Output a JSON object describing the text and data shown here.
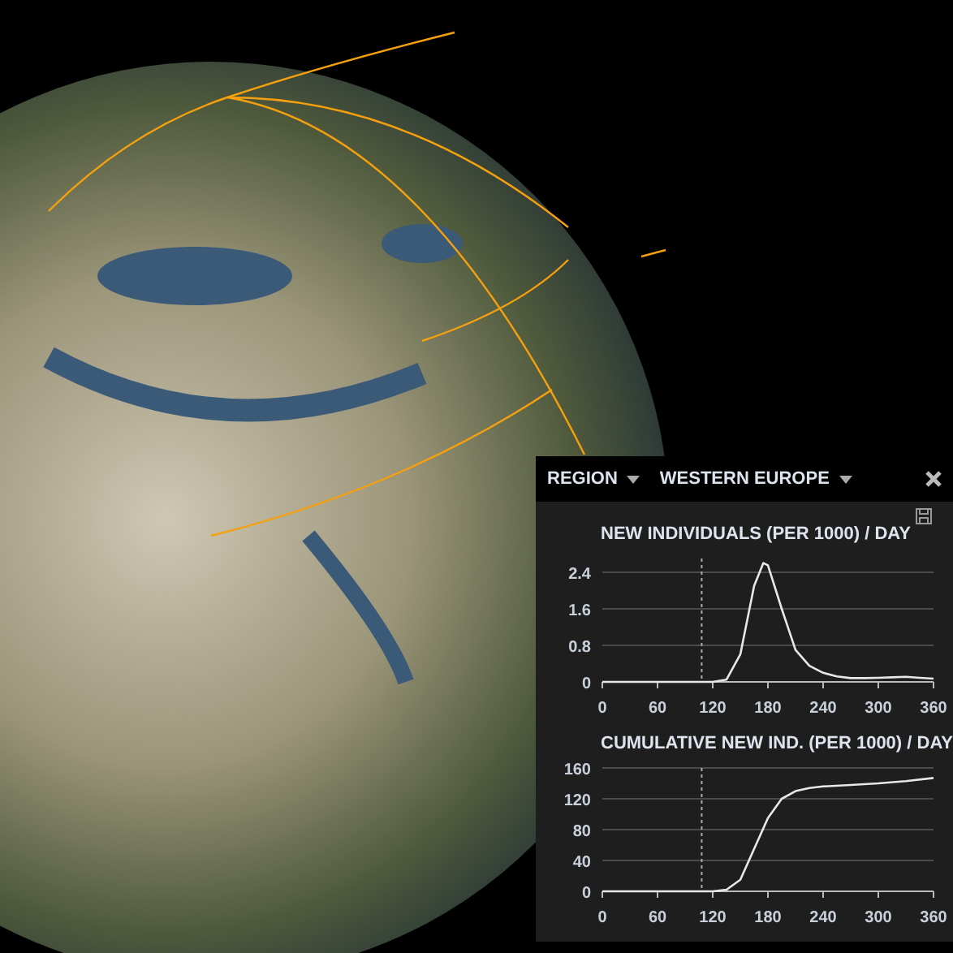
{
  "panel": {
    "region_label": "REGION",
    "region_value": "WESTERN EUROPE",
    "charts": [
      {
        "chart_data": {
          "type": "line",
          "title": "NEW INDIVIDUALS (PER 1000) / DAY",
          "x": [
            0,
            15,
            30,
            45,
            60,
            75,
            90,
            105,
            120,
            135,
            150,
            165,
            175,
            180,
            195,
            210,
            225,
            240,
            255,
            270,
            285,
            300,
            315,
            330,
            345,
            360
          ],
          "series": [
            {
              "color": "#e8e8e8",
              "values": [
                0,
                0,
                0,
                0,
                0,
                0,
                0,
                0,
                0,
                0.05,
                0.6,
                2.1,
                2.6,
                2.55,
                1.6,
                0.7,
                0.35,
                0.2,
                0.12,
                0.08,
                0.08,
                0.09,
                0.1,
                0.11,
                0.09,
                0.07
              ]
            }
          ],
          "grid": true,
          "xlim": [
            0,
            360
          ],
          "ylim": [
            0,
            2.7
          ],
          "ref_lines": [
            {
              "axis": "x",
              "value": 108
            }
          ],
          "xticks": [
            0,
            60,
            120,
            180,
            240,
            300,
            360
          ],
          "yticks": [
            {
              "value": 0,
              "label": "0"
            },
            {
              "value": 0.8,
              "label": "0.8"
            },
            {
              "value": 1.6,
              "label": "1.6"
            },
            {
              "value": 2.4,
              "label": "2.4"
            }
          ]
        }
      },
      {
        "chart_data": {
          "type": "line",
          "title": "CUMULATIVE NEW IND. (PER 1000) / DAY",
          "x": [
            0,
            15,
            30,
            45,
            60,
            75,
            90,
            105,
            120,
            135,
            150,
            165,
            180,
            195,
            210,
            225,
            240,
            270,
            300,
            330,
            360
          ],
          "series": [
            {
              "color": "#e8e8e8",
              "values": [
                0,
                0,
                0,
                0,
                0,
                0,
                0,
                0,
                0,
                2,
                15,
                55,
                95,
                120,
                130,
                134,
                136,
                138,
                140,
                143,
                147
              ]
            }
          ],
          "grid": true,
          "xlim": [
            0,
            360
          ],
          "ylim": [
            0,
            160
          ],
          "ref_lines": [
            {
              "axis": "x",
              "value": 108
            }
          ],
          "xticks": [
            0,
            60,
            120,
            180,
            240,
            300,
            360
          ],
          "yticks": [
            0,
            40,
            80,
            120,
            160
          ]
        }
      }
    ]
  }
}
